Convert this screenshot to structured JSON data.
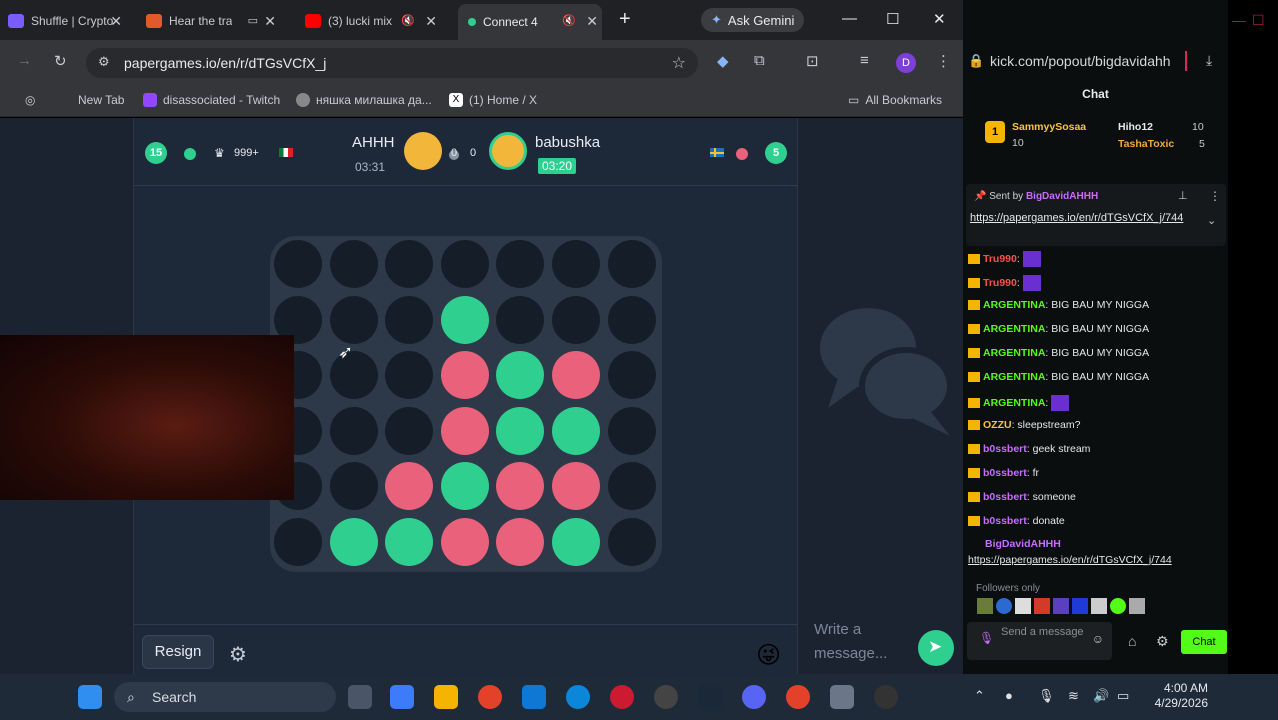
{
  "browser": {
    "tabs": [
      {
        "title": "Shuffle | Crypto",
        "favicon_color": "#7b5cff"
      },
      {
        "title": "Hear the tra",
        "favicon_color": "#e05a2b"
      },
      {
        "title": "(3) lucki mix",
        "favicon_color": "#ff0000"
      },
      {
        "title": "Connect 4",
        "favicon_color": "#2fcf8f"
      }
    ],
    "new_tab_symbol": "+",
    "gemini_label": "Ask Gemini",
    "url": "papergames.io/en/r/dTGsVCfX_j",
    "profile_initial": "D",
    "bookmarks": [
      {
        "label": "New Tab"
      },
      {
        "label": "disassociated - Twitch"
      },
      {
        "label": "няшка милашка да..."
      },
      {
        "label": "(1) Home / X"
      }
    ],
    "all_bookmarks": "All Bookmarks"
  },
  "game": {
    "left_player": {
      "level": "15",
      "rating": "999+",
      "name": "AHHH",
      "time": "03:31",
      "color": "#2fcf8f"
    },
    "score_left": "0",
    "score_right": "0",
    "right_player": {
      "level": "5",
      "name": "babushka",
      "time": "03:20",
      "color": "#e9617a"
    },
    "board": {
      "rows": 6,
      "cols": 7,
      "colors": {
        "empty": "#151d29",
        "red": "#e9617a",
        "green": "#2fcf8f"
      },
      "cells": [
        [
          "empty",
          "empty",
          "empty",
          "empty",
          "empty",
          "empty",
          "empty"
        ],
        [
          "empty",
          "empty",
          "empty",
          "green",
          "empty",
          "empty",
          "empty"
        ],
        [
          "empty",
          "empty",
          "empty",
          "red",
          "green",
          "red",
          "empty"
        ],
        [
          "empty",
          "empty",
          "empty",
          "red",
          "green",
          "green",
          "empty"
        ],
        [
          "empty",
          "empty",
          "red",
          "green",
          "red",
          "red",
          "empty"
        ],
        [
          "empty",
          "green",
          "green",
          "red",
          "red",
          "green",
          "empty"
        ]
      ]
    },
    "resign_label": "Resign",
    "chat_placeholder": "Write a message..."
  },
  "kick": {
    "url": "kick.com/popout/bigdavidahh",
    "title": "Chat",
    "top_gifters": [
      {
        "name": "SammyySosaa",
        "count": "10"
      },
      {
        "name": "Hiho12",
        "count": "10"
      },
      {
        "name": "TashaToxic",
        "count": "5"
      }
    ],
    "pinned_by_label": "Sent by",
    "pinned_user": "BigDavidAHHH",
    "pinned_link": "https://papergames.io/en/r/dTGsVCfX_j/744",
    "messages": [
      {
        "user": "Tru990",
        "text": "",
        "color": "#ff4d4d"
      },
      {
        "user": "Tru990",
        "text": "",
        "color": "#ff4d4d"
      },
      {
        "user": "ARGENTINA",
        "text": "BIG BAU MY NIGGA",
        "color": "#53fc18"
      },
      {
        "user": "ARGENTINA",
        "text": "BIG BAU MY NIGGA",
        "color": "#53fc18"
      },
      {
        "user": "ARGENTINA",
        "text": "BIG BAU MY NIGGA",
        "color": "#53fc18"
      },
      {
        "user": "ARGENTINA",
        "text": "BIG BAU MY NIGGA",
        "color": "#53fc18"
      },
      {
        "user": "ARGENTINA",
        "text": "",
        "color": "#53fc18"
      },
      {
        "user": "OZZU",
        "text": "sleepstream?",
        "color": "#f5c542"
      },
      {
        "user": "b0ssbert",
        "text": "geek stream",
        "color": "#c86bff"
      },
      {
        "user": "b0ssbert",
        "text": "fr",
        "color": "#c86bff"
      },
      {
        "user": "b0ssbert",
        "text": "someone",
        "color": "#c86bff"
      },
      {
        "user": "b0ssbert",
        "text": "donate",
        "color": "#c86bff"
      }
    ],
    "last_user": "BigDavidAHHH",
    "last_link": "https://papergames.io/en/r/dTGsVCfX_j/744",
    "followers_only": "Followers only",
    "input_placeholder": "Send a message",
    "chat_button": "Chat"
  },
  "taskbar": {
    "search_label": "Search",
    "time": "4:00 AM",
    "date": "4/29/2026"
  }
}
